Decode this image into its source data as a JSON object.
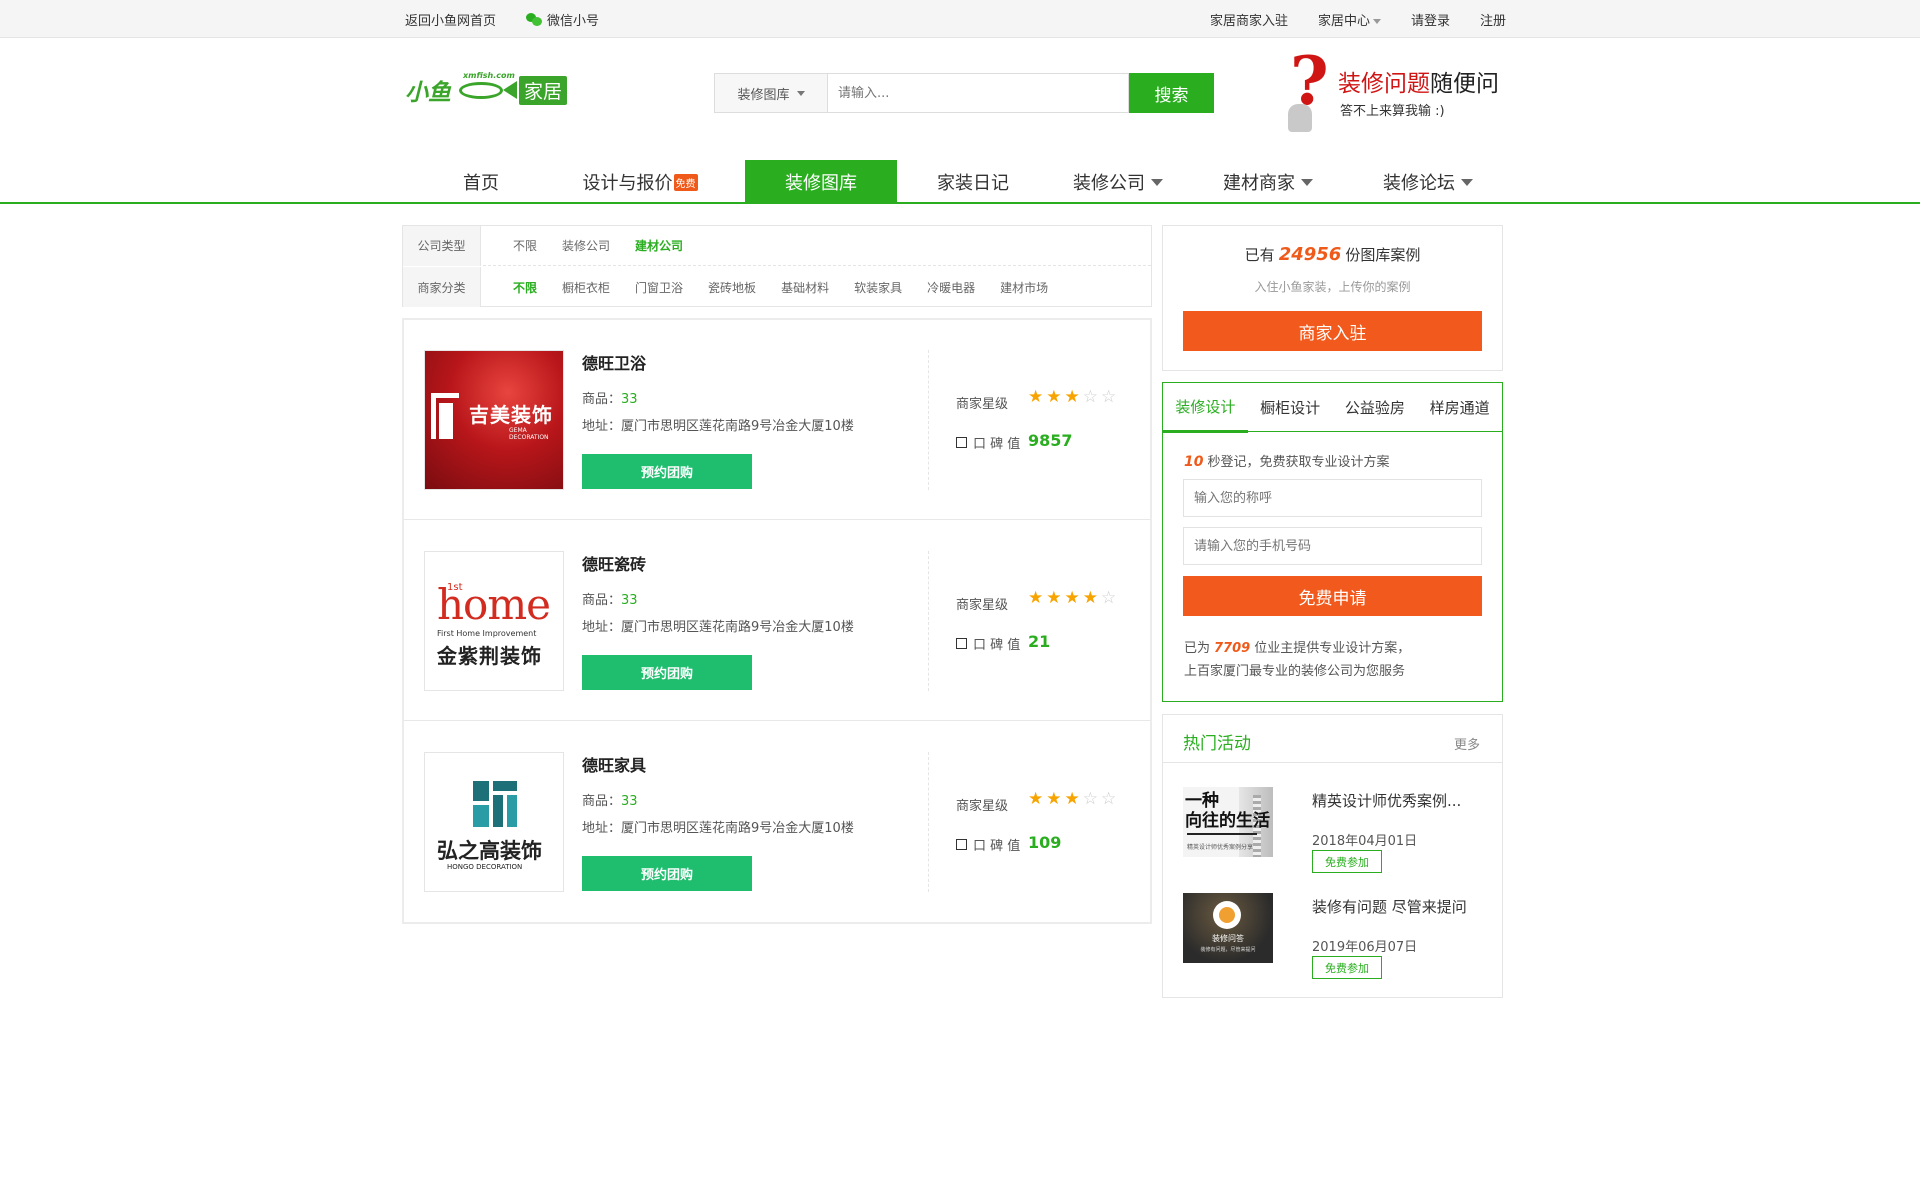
{
  "topbar": {
    "back_home": "返回小鱼网首页",
    "wechat": "微信小号",
    "merchant_join": "家居商家入驻",
    "home_center": "家居中心",
    "login": "请登录",
    "register": "注册"
  },
  "logo": {
    "text_left": "小鱼",
    "url_text": "xmfish.com",
    "text_right": "家居"
  },
  "search": {
    "category": "装修图库",
    "placeholder": "请输入...",
    "button": "搜索"
  },
  "ask": {
    "title_highlight": "装修问题",
    "title_rest": "随便问",
    "subtitle": "答不上来算我输 :)"
  },
  "nav": {
    "items": [
      {
        "label": "首页"
      },
      {
        "label": "设计与报价",
        "badge": "免费"
      },
      {
        "label": "装修图库"
      },
      {
        "label": "家装日记"
      },
      {
        "label": "装修公司"
      },
      {
        "label": "建材商家"
      },
      {
        "label": "装修论坛"
      }
    ]
  },
  "filter": {
    "row1_label": "公司类型",
    "row1_options": [
      "不限",
      "装修公司",
      "建材公司"
    ],
    "row1_selected": "建材公司",
    "row2_label": "商家分类",
    "row2_options": [
      "不限",
      "橱柜衣柜",
      "门窗卫浴",
      "瓷砖地板",
      "基础材料",
      "软装家具",
      "冷暖电器",
      "建材市场"
    ],
    "row2_selected": "不限"
  },
  "labels": {
    "goods_prefix": "商品：",
    "address_prefix": "地址：",
    "book_button": "预约团购",
    "star_label": "商家星级",
    "reputation_label": "口 碑 值"
  },
  "merchants": [
    {
      "name": "德旺卫浴",
      "goods": "33",
      "address": "厦门市思明区莲花南路9号冶金大厦10楼",
      "stars": 3,
      "reputation": "9857",
      "logo_text": "吉美装饰",
      "logo_en": "GEMA DECORATION"
    },
    {
      "name": "德旺瓷砖",
      "goods": "33",
      "address": "厦门市思明区莲花南路9号冶金大厦10楼",
      "stars": 4,
      "reputation": "21",
      "logo_text": "home",
      "logo_sup": "1st",
      "logo_en": "First Home Improvement",
      "logo_cn": "金紫荆装饰"
    },
    {
      "name": "德旺家具",
      "goods": "33",
      "address": "厦门市思明区莲花南路9号冶金大厦10楼",
      "stars": 3,
      "reputation": "109",
      "logo_text": "弘之高装饰",
      "logo_en": "HONGO DECORATION"
    }
  ],
  "sidebar_case": {
    "prefix": "已有",
    "count": "24956",
    "suffix": "份图库案例",
    "subtitle": "入住小鱼家装，上传你的案例",
    "button": "商家入驻"
  },
  "sidebar_design": {
    "tabs": [
      "装修设计",
      "橱柜设计",
      "公益验房",
      "样房通道"
    ],
    "active_tab": "装修设计",
    "tip_number": "10",
    "tip_text": "秒登记，免费获取专业设计方案",
    "name_placeholder": "输入您的称呼",
    "phone_placeholder": "请输入您的手机号码",
    "button": "免费申请",
    "note_prefix": "已为",
    "note_count": "7709",
    "note_suffix": "位业主提供专业设计方案，",
    "note_line2": "上百家厦门最专业的装修公司为您服务"
  },
  "sidebar_activities": {
    "title": "热门活动",
    "more": "更多",
    "join_label": "免费参加",
    "items": [
      {
        "title": "精英设计师优秀案例...",
        "date": "2018年04月01日",
        "img_text": "一种\n向往的生活",
        "img_sub": "精英设计师优秀案例分享"
      },
      {
        "title": "装修有问题 尽管来提问",
        "date": "2019年06月07日",
        "img_text": "装修问答",
        "img_sub": "装修有问题，尽管来提问"
      }
    ]
  },
  "colors": {
    "brand_green": "#2aae20",
    "button_green": "#1fbe6f",
    "accent_orange": "#f25a1d",
    "red": "#d01515",
    "star": "#f7a400"
  }
}
